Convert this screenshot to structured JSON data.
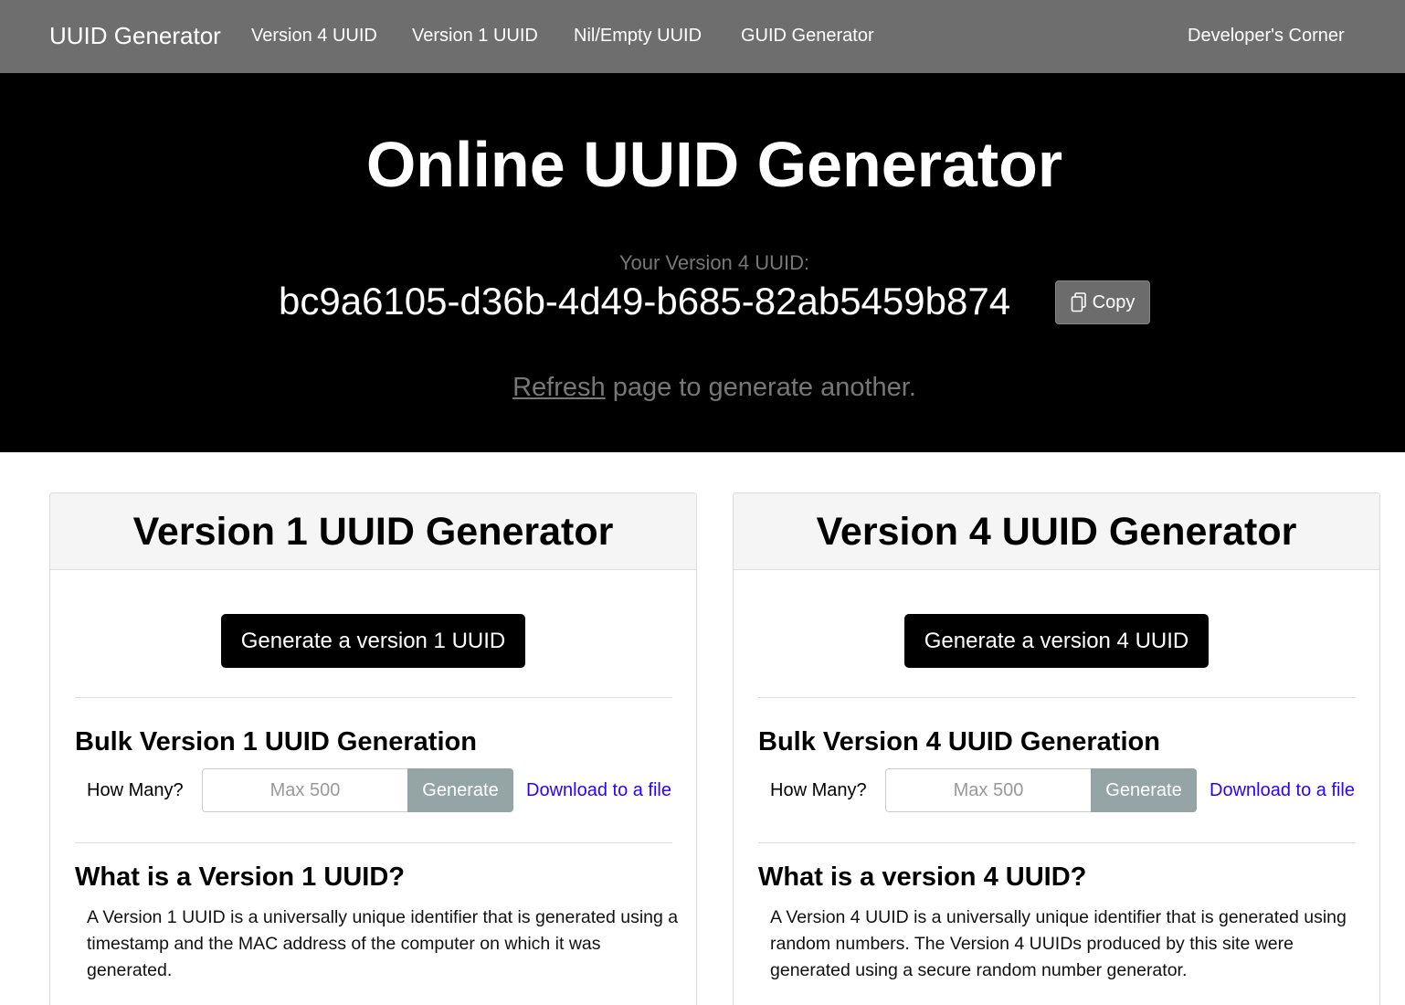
{
  "nav": {
    "brand": "UUID Generator",
    "links": [
      "Version 4 UUID",
      "Version 1 UUID",
      "Nil/Empty UUID",
      "GUID Generator"
    ],
    "right_link": "Developer's Corner"
  },
  "hero": {
    "title": "Online UUID Generator",
    "uuid_label": "Your Version 4 UUID:",
    "uuid_value": "bc9a6105-d36b-4d49-b685-82ab5459b874",
    "copy_label": "Copy",
    "refresh_link": "Refresh",
    "refresh_rest": " page to generate another."
  },
  "cards": [
    {
      "title": "Version 1 UUID Generator",
      "generate_button": "Generate a version 1 UUID",
      "bulk_title": "Bulk Version 1 UUID Generation",
      "how_many_label": "How Many?",
      "input_placeholder": "Max 500",
      "bulk_button": "Generate",
      "download_link": "Download to a file",
      "what_title": "What is a Version 1 UUID?",
      "what_desc": "A Version 1 UUID is a universally unique identifier that is generated using a timestamp and the MAC address of the computer on which it was generated."
    },
    {
      "title": "Version 4 UUID Generator",
      "generate_button": "Generate a version 4 UUID",
      "bulk_title": "Bulk Version 4 UUID Generation",
      "how_many_label": "How Many?",
      "input_placeholder": "Max 500",
      "bulk_button": "Generate",
      "download_link": "Download to a file",
      "what_title": "What is a version 4 UUID?",
      "what_desc": "A Version 4 UUID is a universally unique identifier that is generated using random numbers. The Version 4 UUIDs produced by this site were generated using a secure random number generator."
    }
  ],
  "colors": {
    "nav_bg": "#6e6e6e",
    "hero_bg": "#000000",
    "bulk_button_bg": "#95a5a6",
    "link": "#2b00ff"
  },
  "icons": {
    "copy": "copy-icon"
  }
}
